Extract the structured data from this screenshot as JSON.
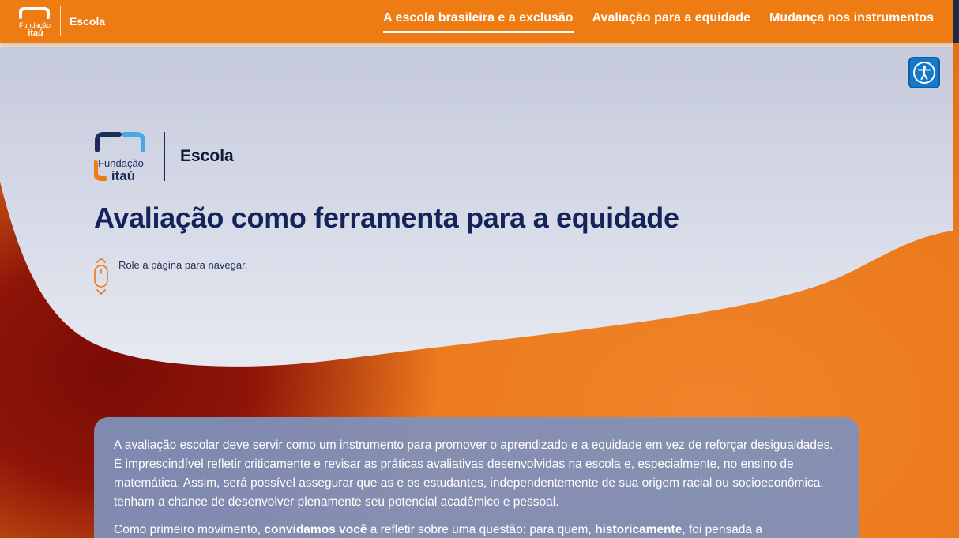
{
  "header": {
    "logo_text_top": "Fundação",
    "logo_text_bottom": "itaú",
    "brand_label": "Escola",
    "nav": [
      {
        "label": "A escola brasileira e a exclusão",
        "active": true
      },
      {
        "label": "Avaliação para a equidade",
        "active": false
      },
      {
        "label": "Mudança nos instrumentos",
        "active": false
      }
    ]
  },
  "accessibility": {
    "icon": "accessibility-icon"
  },
  "hero": {
    "logo_text_top": "Fundação",
    "logo_text_bottom": "itaú",
    "brand_label": "Escola",
    "title": "Avaliação como ferramenta para a equidade",
    "scroll_hint": "Role a página para navegar."
  },
  "intro": {
    "paragraph1": "A avaliação escolar deve servir como um instrumento para promover o aprendizado e a equidade em vez de reforçar desigualdades. É imprescindível refletir criticamente e revisar as práticas avaliativas desenvolvidas na escola e, especialmente, no ensino de matemática. Assim, será possível assegurar que as e os estudantes, independentemente de sua origem racial ou socioeconômica, tenham a chance de desenvolver plenamente seu potencial acadêmico e pessoal.",
    "p2_part1": "Como primeiro movimento, ",
    "p2_bold1": "convidamos você",
    "p2_part2": " a refletir sobre uma questão: para quem, ",
    "p2_bold2": "historicamente",
    "p2_part3": ", foi pensada a"
  },
  "colors": {
    "header_orange": "#ef7c12",
    "navy": "#14245a",
    "logo_blue": "#1479c9",
    "card": "#8090ba"
  }
}
